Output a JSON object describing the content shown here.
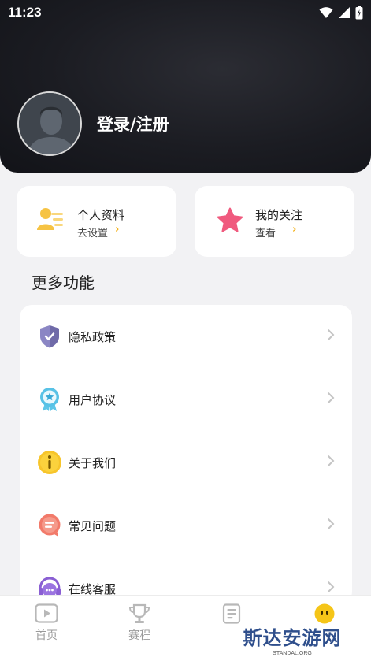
{
  "status_bar": {
    "time": "11:23"
  },
  "header": {
    "login_label": "登录/注册"
  },
  "cards": [
    {
      "title": "个人资料",
      "subtitle": "去设置",
      "arrow": "›"
    },
    {
      "title": "我的关注",
      "subtitle": "查看",
      "arrow": "›"
    }
  ],
  "section": {
    "title": "更多功能"
  },
  "menu": {
    "items": [
      {
        "label": "隐私政策",
        "icon": "shield-check-icon"
      },
      {
        "label": "用户协议",
        "icon": "badge-star-icon"
      },
      {
        "label": "关于我们",
        "icon": "info-icon"
      },
      {
        "label": "常见问题",
        "icon": "chat-bubble-icon"
      },
      {
        "label": "在线客服",
        "icon": "headset-icon"
      }
    ]
  },
  "tabbar": {
    "tabs": [
      {
        "label": "首页",
        "icon": "play-icon"
      },
      {
        "label": "赛程",
        "icon": "trophy-icon"
      },
      {
        "label": "",
        "icon": "document-icon"
      },
      {
        "label": "",
        "icon": "profile-face-icon",
        "active": true
      }
    ]
  },
  "watermark": {
    "main": "斯达安游网",
    "sub": "STANDAL.ORG"
  },
  "colors": {
    "accent": "#f3b21d",
    "header_bg": "#1b1c22",
    "page_bg": "#f2f2f4"
  }
}
